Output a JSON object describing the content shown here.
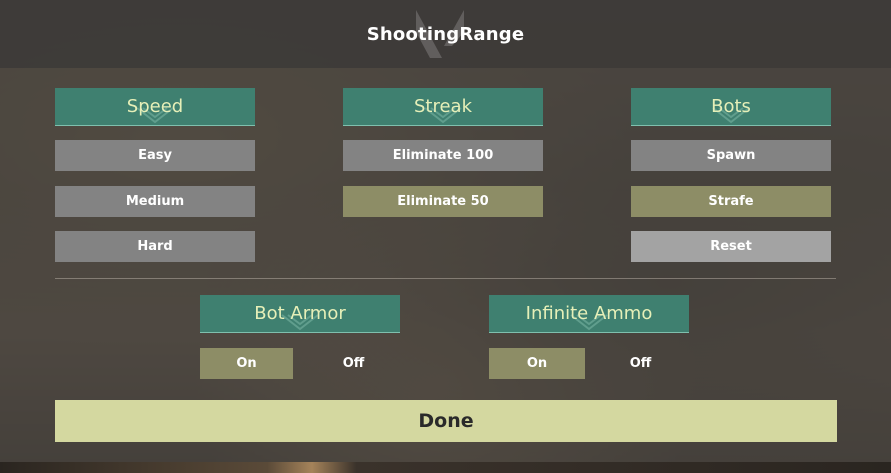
{
  "title": "ShootingRange",
  "sections": {
    "speed": {
      "header": "Speed",
      "options": [
        "Easy",
        "Medium",
        "Hard"
      ]
    },
    "streak": {
      "header": "Streak",
      "options": [
        "Eliminate 100",
        "Eliminate 50"
      ],
      "selected": "Eliminate 50"
    },
    "bots": {
      "header": "Bots",
      "options": [
        "Spawn",
        "Strafe",
        "Reset"
      ],
      "selected": "Strafe"
    },
    "bot_armor": {
      "header": "Bot Armor",
      "on_label": "On",
      "off_label": "Off",
      "value": "On"
    },
    "infinite_ammo": {
      "header": "Infinite Ammo",
      "on_label": "On",
      "off_label": "Off",
      "value": "On"
    }
  },
  "done_label": "Done",
  "colors": {
    "header_bg": "#3f8070",
    "header_text": "#e6efb8",
    "button_bg": "#838383",
    "selected_bg": "#8d8d66",
    "done_bg": "#d4d8a0"
  },
  "icons": {
    "title_logo": "valorant-logo-icon",
    "header_chevron": "chevron-down-icon"
  }
}
